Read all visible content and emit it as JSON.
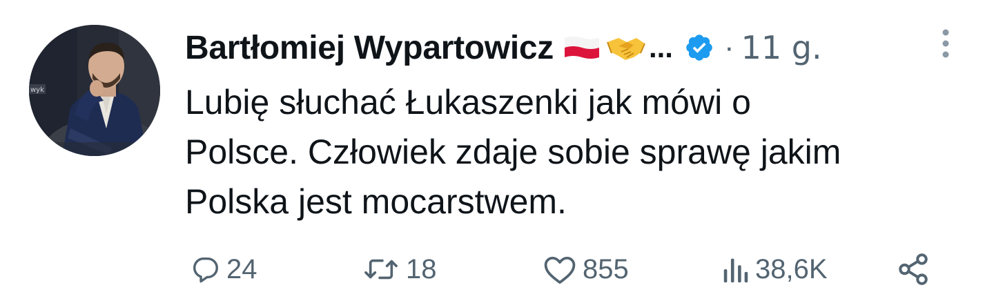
{
  "tweet": {
    "author_name": "Bartłomiej Wypartowicz",
    "name_ellipsis": "...",
    "separator": "·",
    "time_ago": "11 g.",
    "text": "Lubię słuchać Łukaszenki jak mówi o\nPolsce. Człowiek zdaje sobie sprawę jakim\nPolska jest mocarstwem.",
    "verified_color": "#1d9bf0"
  },
  "icons": {
    "name_emojis": [
      "poland-flag-icon",
      "handshake-icon"
    ],
    "verified": "verified-badge-icon",
    "more": "more-vertical-icon"
  },
  "actions": {
    "reply_count": "24",
    "retweet_count": "18",
    "like_count": "855",
    "views_count": "38,6K"
  },
  "colors": {
    "text_primary": "#0f1419",
    "text_secondary": "#536471",
    "accent": "#1d9bf0"
  }
}
